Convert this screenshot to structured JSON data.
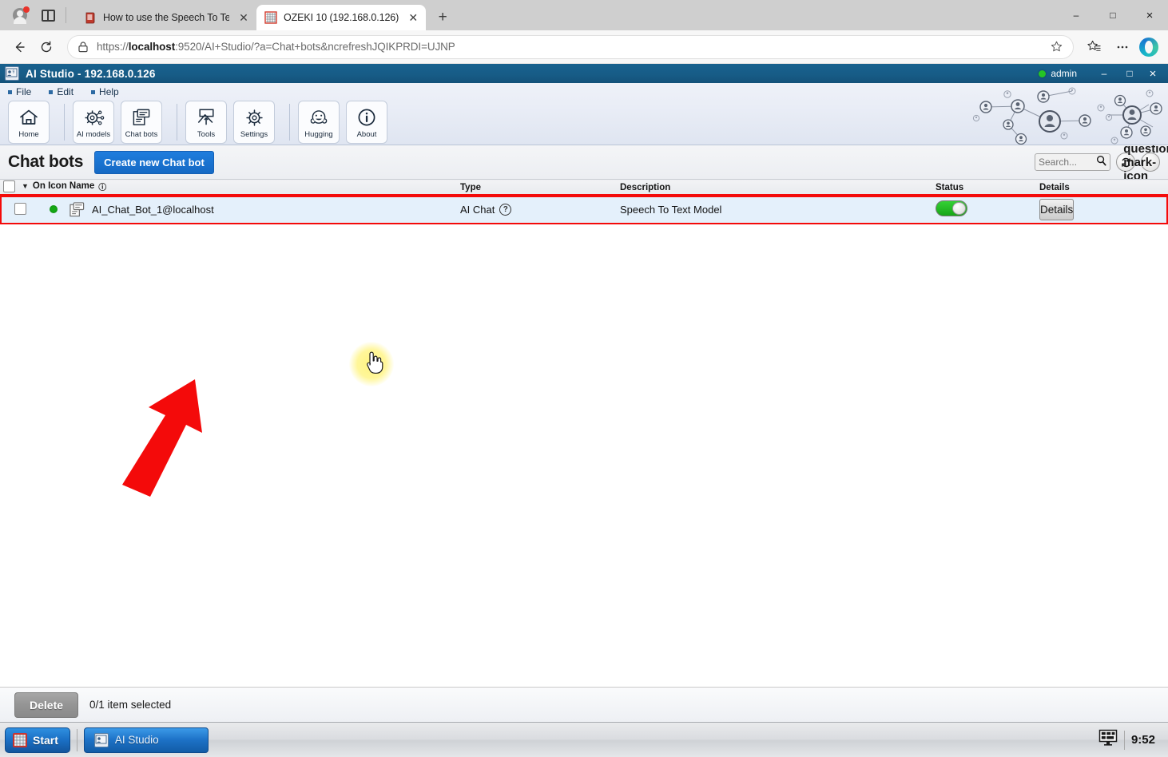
{
  "browser": {
    "tabs": [
      {
        "title": "How to use the Speech To Text m",
        "favicon": "book-icon",
        "active": false
      },
      {
        "title": "OZEKI 10 (192.168.0.126)",
        "favicon": "ozeki-grid-icon",
        "active": true
      }
    ],
    "new_tab_label": "+",
    "window_controls": {
      "minimize": "–",
      "maximize": "□",
      "close": "×"
    },
    "nav": {
      "back": "←",
      "reload": "⟳"
    },
    "address": {
      "scheme": "https://",
      "host": "localhost",
      "rest": ":9520/AI+Studio/?a=Chat+bots&ncrefreshJQIKPRDI=UJNP",
      "full": "https://localhost:9520/AI+Studio/?a=Chat+bots&ncrefreshJQIKPRDI=UJNP"
    },
    "toolbar_icons": [
      "star-icon",
      "favorites-icon",
      "more-icon",
      "copilot-icon"
    ]
  },
  "app": {
    "title": "AI Studio - 192.168.0.126",
    "user": "admin",
    "window_controls": {
      "minimize": "–",
      "maximize": "□",
      "close": "×"
    },
    "menu": [
      "File",
      "Edit",
      "Help"
    ],
    "toolbar": [
      {
        "label": "Home",
        "icon": "home-icon",
        "group": 1
      },
      {
        "label": "AI models",
        "icon": "gear-ai-icon",
        "group": 2
      },
      {
        "label": "Chat bots",
        "icon": "chat-bots-icon",
        "group": 2
      },
      {
        "label": "Tools",
        "icon": "tools-icon",
        "group": 3
      },
      {
        "label": "Settings",
        "icon": "gear-icon",
        "group": 3
      },
      {
        "label": "Hugging",
        "icon": "hugging-face-icon",
        "group": 4
      },
      {
        "label": "About",
        "icon": "info-icon",
        "group": 4
      }
    ]
  },
  "page": {
    "title": "Chat bots",
    "create_button": "Create new Chat bot",
    "search": {
      "value": "",
      "placeholder": "Search..."
    },
    "refresh_icon": "refresh-icon",
    "help_icon": "question-mark-icon",
    "columns": [
      "On",
      "Icon",
      "Name",
      "Type",
      "Description",
      "Status",
      "Details"
    ],
    "column_header_combined": "On Icon Name",
    "rows": [
      {
        "selected": false,
        "on": true,
        "icon": "chat-bot-icon",
        "name": "AI_Chat_Bot_1@localhost",
        "type": "AI Chat",
        "type_help": "?",
        "description": "Speech To Text Model",
        "status_enabled": true,
        "details_label": "Details"
      }
    ],
    "footer": {
      "delete_label": "Delete",
      "selection_text": "0/1 item selected"
    }
  },
  "taskbar": {
    "start_label": "Start",
    "items": [
      {
        "label": "AI Studio",
        "icon": "ai-studio-icon"
      }
    ],
    "tray_icon": "display-icon",
    "clock": "9:52"
  },
  "annotations": {
    "arrow": {
      "color": "#f40a0a",
      "points_to": "chat-bot-row"
    },
    "row_outline_color": "#f40a0a",
    "cursor_highlight_color": "#fff378"
  },
  "colors": {
    "app_titlebar": "#14527a",
    "primary_button": "#1569c4",
    "row_background": "#e4f0fb",
    "status_green": "#17a517",
    "annotation_red": "#f40a0a"
  }
}
